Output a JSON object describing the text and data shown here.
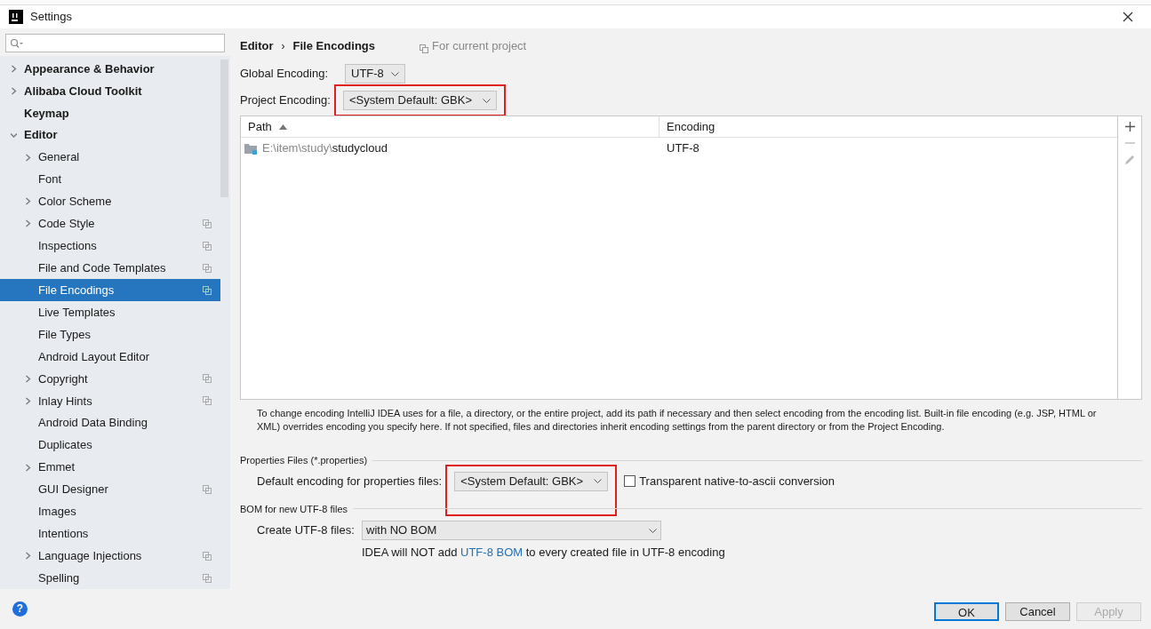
{
  "window": {
    "title": "Settings"
  },
  "sidebar": {
    "items": [
      {
        "label": "Appearance & Behavior",
        "bold": true,
        "expandable": true,
        "expanded": false,
        "selected": false,
        "project_scope": false
      },
      {
        "label": "Alibaba Cloud Toolkit",
        "bold": true,
        "expandable": true,
        "expanded": false,
        "selected": false,
        "project_scope": false
      },
      {
        "label": "Keymap",
        "bold": true,
        "expandable": false,
        "selected": false,
        "project_scope": false
      },
      {
        "label": "Editor",
        "bold": true,
        "expandable": true,
        "expanded": true,
        "selected": false,
        "project_scope": false,
        "children": [
          {
            "label": "General",
            "expandable": true,
            "expanded": false,
            "selected": false,
            "project_scope": false
          },
          {
            "label": "Font",
            "expandable": false,
            "selected": false,
            "project_scope": false
          },
          {
            "label": "Color Scheme",
            "expandable": true,
            "expanded": false,
            "selected": false,
            "project_scope": false
          },
          {
            "label": "Code Style",
            "expandable": true,
            "expanded": false,
            "selected": false,
            "project_scope": true
          },
          {
            "label": "Inspections",
            "expandable": false,
            "selected": false,
            "project_scope": true
          },
          {
            "label": "File and Code Templates",
            "expandable": false,
            "selected": false,
            "project_scope": true
          },
          {
            "label": "File Encodings",
            "expandable": false,
            "selected": true,
            "project_scope": true
          },
          {
            "label": "Live Templates",
            "expandable": false,
            "selected": false,
            "project_scope": false
          },
          {
            "label": "File Types",
            "expandable": false,
            "selected": false,
            "project_scope": false
          },
          {
            "label": "Android Layout Editor",
            "expandable": false,
            "selected": false,
            "project_scope": false
          },
          {
            "label": "Copyright",
            "expandable": true,
            "expanded": false,
            "selected": false,
            "project_scope": true
          },
          {
            "label": "Inlay Hints",
            "expandable": true,
            "expanded": false,
            "selected": false,
            "project_scope": true
          },
          {
            "label": "Android Data Binding",
            "expandable": false,
            "selected": false,
            "project_scope": false
          },
          {
            "label": "Duplicates",
            "expandable": false,
            "selected": false,
            "project_scope": false
          },
          {
            "label": "Emmet",
            "expandable": true,
            "expanded": false,
            "selected": false,
            "project_scope": false
          },
          {
            "label": "GUI Designer",
            "expandable": false,
            "selected": false,
            "project_scope": true
          },
          {
            "label": "Images",
            "expandable": false,
            "selected": false,
            "project_scope": false
          },
          {
            "label": "Intentions",
            "expandable": false,
            "selected": false,
            "project_scope": false
          },
          {
            "label": "Language Injections",
            "expandable": true,
            "expanded": false,
            "selected": false,
            "project_scope": true
          },
          {
            "label": "Spelling",
            "expandable": false,
            "selected": false,
            "project_scope": true
          }
        ]
      }
    ]
  },
  "help_button": "?",
  "breadcrumb": [
    "Editor",
    "File Encodings"
  ],
  "breadcrumb_separator": "›",
  "scope_note": "For current project",
  "global_encoding": {
    "label": "Global Encoding:",
    "value": "UTF-8",
    "highlighted": false
  },
  "project_encoding": {
    "label": "Project Encoding:",
    "value": "<System Default: GBK>",
    "highlighted": true
  },
  "table": {
    "columns": [
      {
        "label": "Path",
        "sorted": true
      },
      {
        "label": "Encoding",
        "sorted": false
      }
    ],
    "rows": [
      {
        "path_prefix": "E:\\item\\study\\",
        "path_name": "studycloud",
        "encoding": "UTF-8"
      }
    ]
  },
  "help_text": "To change encoding IntelliJ IDEA uses for a file, a directory, or the entire project, add its path if necessary and then select encoding from the encoding list. Built-in file encoding (e.g. JSP, HTML or XML) overrides encoding you specify here. If not specified, files and directories inherit encoding settings from the parent directory or from the Project Encoding.",
  "properties": {
    "heading": "Properties Files (*.properties)",
    "label": "Default encoding for properties files:",
    "value": "<System Default: GBK>",
    "highlighted": true,
    "checkbox": {
      "label": "Transparent native-to-ascii conversion",
      "checked": false
    }
  },
  "bom": {
    "heading": "BOM for new UTF-8 files",
    "label": "Create UTF-8 files:",
    "value": "with NO BOM",
    "note_before": "IDEA will NOT add ",
    "note_link": "UTF-8 BOM",
    "note_after": " to every created file in UTF-8 encoding"
  },
  "buttons": [
    {
      "label": "OK",
      "default": true,
      "disabled": false
    },
    {
      "label": "Cancel",
      "default": false,
      "disabled": false
    },
    {
      "label": "Apply",
      "default": false,
      "disabled": true
    }
  ]
}
